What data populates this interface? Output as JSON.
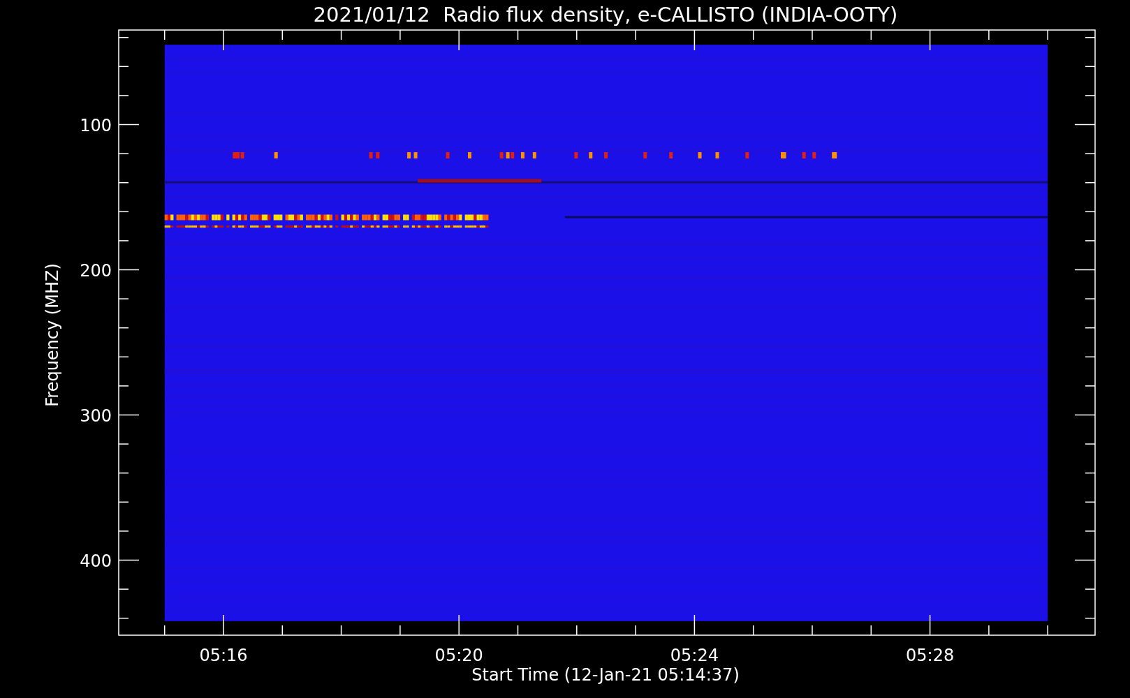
{
  "title": "2021/01/12  Radio flux density, e-CALLISTO (INDIA-OOTY)",
  "y_axis": {
    "label": "Frequency (MHZ)",
    "ticks": [
      "100",
      "200",
      "300",
      "400"
    ]
  },
  "x_axis": {
    "label": "Start Time (12-Jan-21 05:14:37)",
    "ticks": [
      "05:16",
      "05:20",
      "05:24",
      "05:28"
    ]
  }
}
